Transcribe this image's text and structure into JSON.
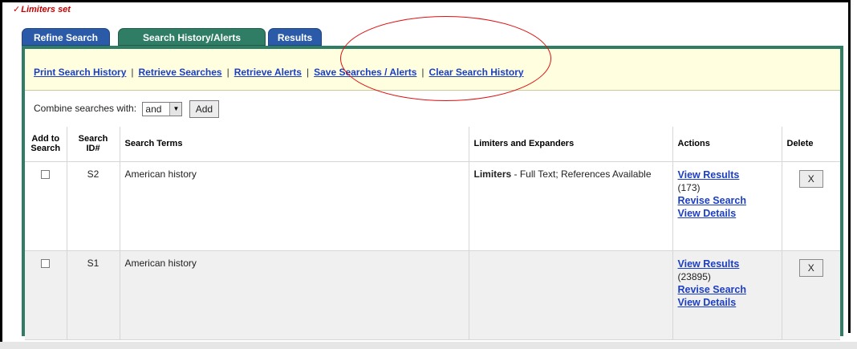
{
  "flag": {
    "check": "✓",
    "text": "Limiters set"
  },
  "tabs": [
    {
      "label": "Refine Search",
      "active": false
    },
    {
      "label": "Search History/Alerts",
      "active": true
    },
    {
      "label": "Results",
      "active": false
    }
  ],
  "action_links": [
    "Print Search History",
    "Retrieve Searches",
    "Retrieve Alerts",
    "Save Searches / Alerts",
    "Clear Search History"
  ],
  "link_separator": "|",
  "combine": {
    "label": "Combine searches with:",
    "selected": "and",
    "add_label": "Add"
  },
  "table": {
    "headers": {
      "add": [
        "Add to",
        "Search"
      ],
      "id": [
        "Search",
        "ID#"
      ],
      "terms": "Search Terms",
      "limiters": "Limiters and Expanders",
      "actions": "Actions",
      "delete": "Delete"
    },
    "rows": [
      {
        "id": "S2",
        "terms": "American history",
        "limiters_label": "Limiters",
        "limiters_text": " - Full Text; References Available",
        "view_results": "View Results",
        "count": "(173)",
        "revise": "Revise Search",
        "details": "View Details",
        "delete": "X"
      },
      {
        "id": "S1",
        "terms": "American history",
        "limiters_label": "",
        "limiters_text": "",
        "view_results": "View Results",
        "count": "(23895)",
        "revise": "Revise Search",
        "details": "View Details",
        "delete": "X"
      }
    ]
  },
  "colors": {
    "accent_green": "#2f7d65",
    "tab_blue": "#2a5aa8",
    "link_blue": "#1c3ec4",
    "flag_red": "#cc0000",
    "action_bar": "#ffffe0",
    "annotation": "#e01010"
  },
  "icons": {
    "dropdown": "▼"
  }
}
